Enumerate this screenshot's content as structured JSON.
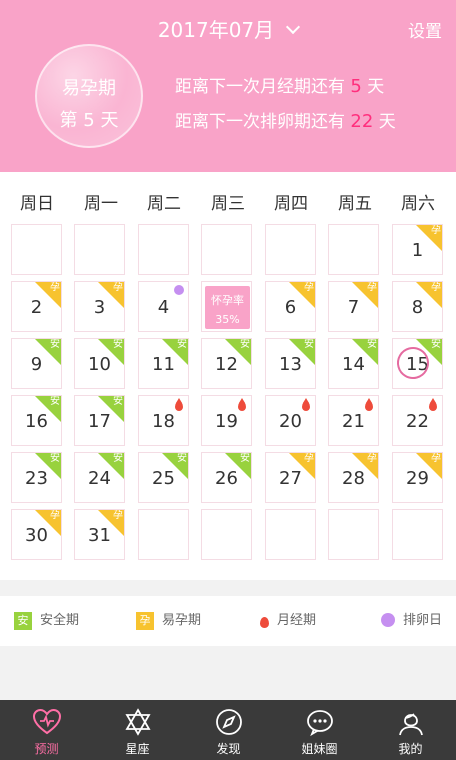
{
  "header": {
    "month": "2017年07月",
    "settings_label": "设置",
    "cycle_phase": "易孕期",
    "cycle_day": "第 5 天",
    "period_prefix": "距离下一次月经期还有",
    "period_days": "5",
    "period_suffix": "天",
    "ovulation_prefix": "距离下一次排卵期还有",
    "ovulation_days": "22",
    "ovulation_suffix": "天"
  },
  "weekdays": [
    "周日",
    "周一",
    "周二",
    "周三",
    "周四",
    "周五",
    "周六"
  ],
  "calendar": [
    [
      {
        "day": "",
        "tag": ""
      },
      {
        "day": "",
        "tag": ""
      },
      {
        "day": "",
        "tag": ""
      },
      {
        "day": "",
        "tag": ""
      },
      {
        "day": "",
        "tag": ""
      },
      {
        "day": "",
        "tag": ""
      },
      {
        "day": "1",
        "tag": "孕"
      }
    ],
    [
      {
        "day": "2",
        "tag": "孕"
      },
      {
        "day": "3",
        "tag": "孕"
      },
      {
        "day": "4",
        "tag": "",
        "ovulation": true
      },
      {
        "day": "",
        "tag": "",
        "badge": true
      },
      {
        "day": "6",
        "tag": "孕"
      },
      {
        "day": "7",
        "tag": "孕"
      },
      {
        "day": "8",
        "tag": "孕"
      }
    ],
    [
      {
        "day": "9",
        "tag": "安"
      },
      {
        "day": "10",
        "tag": "安"
      },
      {
        "day": "11",
        "tag": "安"
      },
      {
        "day": "12",
        "tag": "安"
      },
      {
        "day": "13",
        "tag": "安"
      },
      {
        "day": "14",
        "tag": "安"
      },
      {
        "day": "15",
        "tag": "安",
        "today": true
      }
    ],
    [
      {
        "day": "16",
        "tag": "安"
      },
      {
        "day": "17",
        "tag": "安"
      },
      {
        "day": "18",
        "tag": "",
        "period": true
      },
      {
        "day": "19",
        "tag": "",
        "period": true
      },
      {
        "day": "20",
        "tag": "",
        "period": true
      },
      {
        "day": "21",
        "tag": "",
        "period": true
      },
      {
        "day": "22",
        "tag": "",
        "period": true
      }
    ],
    [
      {
        "day": "23",
        "tag": "安"
      },
      {
        "day": "24",
        "tag": "安"
      },
      {
        "day": "25",
        "tag": "安"
      },
      {
        "day": "26",
        "tag": "安"
      },
      {
        "day": "27",
        "tag": "孕"
      },
      {
        "day": "28",
        "tag": "孕"
      },
      {
        "day": "29",
        "tag": "孕"
      }
    ],
    [
      {
        "day": "30",
        "tag": "孕"
      },
      {
        "day": "31",
        "tag": "孕"
      },
      {
        "day": "",
        "tag": ""
      },
      {
        "day": "",
        "tag": ""
      },
      {
        "day": "",
        "tag": ""
      },
      {
        "day": "",
        "tag": ""
      },
      {
        "day": "",
        "tag": ""
      }
    ]
  ],
  "pregnancy_badge": {
    "label": "怀孕率",
    "rate": "35%"
  },
  "legend": {
    "safe_icon": "安",
    "safe_label": "安全期",
    "fertile_icon": "孕",
    "fertile_label": "易孕期",
    "period_label": "月经期",
    "ovulation_label": "排卵日"
  },
  "colors": {
    "header_pink": "#f9a3c8",
    "fertile_yellow": "#f7c32f",
    "safe_green": "#98d23e",
    "period_red": "#ee4b3b",
    "ovulation_purple": "#c58ff0",
    "highlight_pink": "#ff2f7d"
  },
  "nav": {
    "items": [
      {
        "label": "预测",
        "icon": "heart-pulse-icon"
      },
      {
        "label": "星座",
        "icon": "star-of-david-icon"
      },
      {
        "label": "发现",
        "icon": "compass-icon"
      },
      {
        "label": "姐妹圈",
        "icon": "chat-bubble-icon"
      },
      {
        "label": "我的",
        "icon": "user-profile-icon"
      }
    ]
  }
}
